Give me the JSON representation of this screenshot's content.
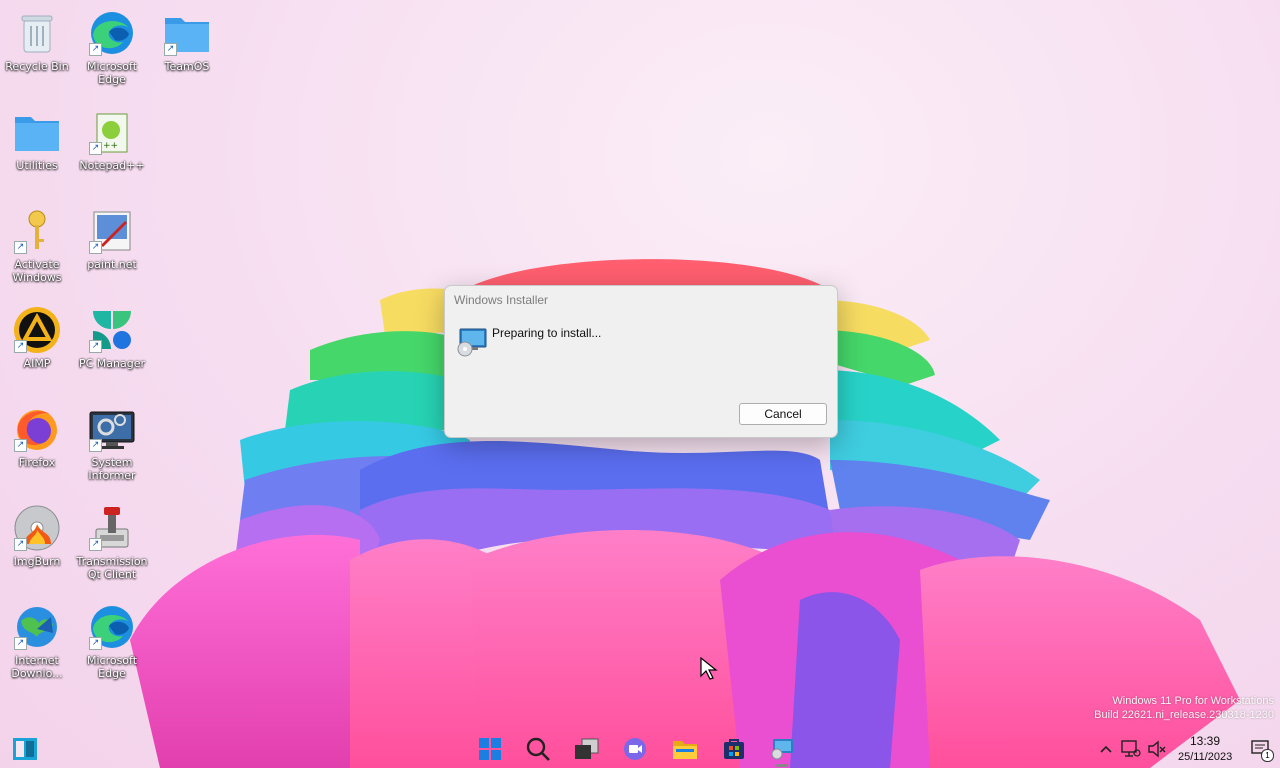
{
  "desktop": {
    "icons": [
      {
        "label": "Recycle Bin",
        "icon": "recycle-bin-icon"
      },
      {
        "label": "Microsoft Edge",
        "icon": "edge-icon"
      },
      {
        "label": "TeamOS",
        "icon": "folder-icon"
      },
      {
        "label": "Utilities",
        "icon": "folder-icon"
      },
      {
        "label": "Notepad++",
        "icon": "notepadpp-icon"
      },
      {
        "label": "Activate Windows",
        "icon": "key-icon"
      },
      {
        "label": "paint.net",
        "icon": "paintnet-icon"
      },
      {
        "label": "AIMP",
        "icon": "aimp-icon"
      },
      {
        "label": "PC Manager",
        "icon": "pc-manager-icon"
      },
      {
        "label": "Firefox",
        "icon": "firefox-icon"
      },
      {
        "label": "System Informer",
        "icon": "system-informer-icon"
      },
      {
        "label": "ImgBurn",
        "icon": "imgburn-icon"
      },
      {
        "label": "Transmission Qt Client",
        "icon": "transmission-icon"
      },
      {
        "label": "Internet Downlo...",
        "icon": "idm-icon"
      },
      {
        "label": "Microsoft Edge",
        "icon": "edge-icon"
      }
    ]
  },
  "dialog": {
    "title": "Windows Installer",
    "message": "Preparing to install...",
    "cancel_label": "Cancel"
  },
  "watermark": {
    "line1": "Windows 11 Pro for Workstations",
    "line2": "Build 22621.ni_release.230318-1230"
  },
  "tray": {
    "time": "13:39",
    "date": "25/11/2023",
    "notification_count": "1"
  },
  "taskbar": {
    "items": [
      "widgets-icon",
      "start-icon",
      "search-icon",
      "task-view-icon",
      "meet-icon",
      "file-explorer-icon",
      "store-icon",
      "windows-installer-icon"
    ]
  },
  "colors": {
    "accent": "#0078d4",
    "dialog_bg": "#f0f0f0"
  }
}
